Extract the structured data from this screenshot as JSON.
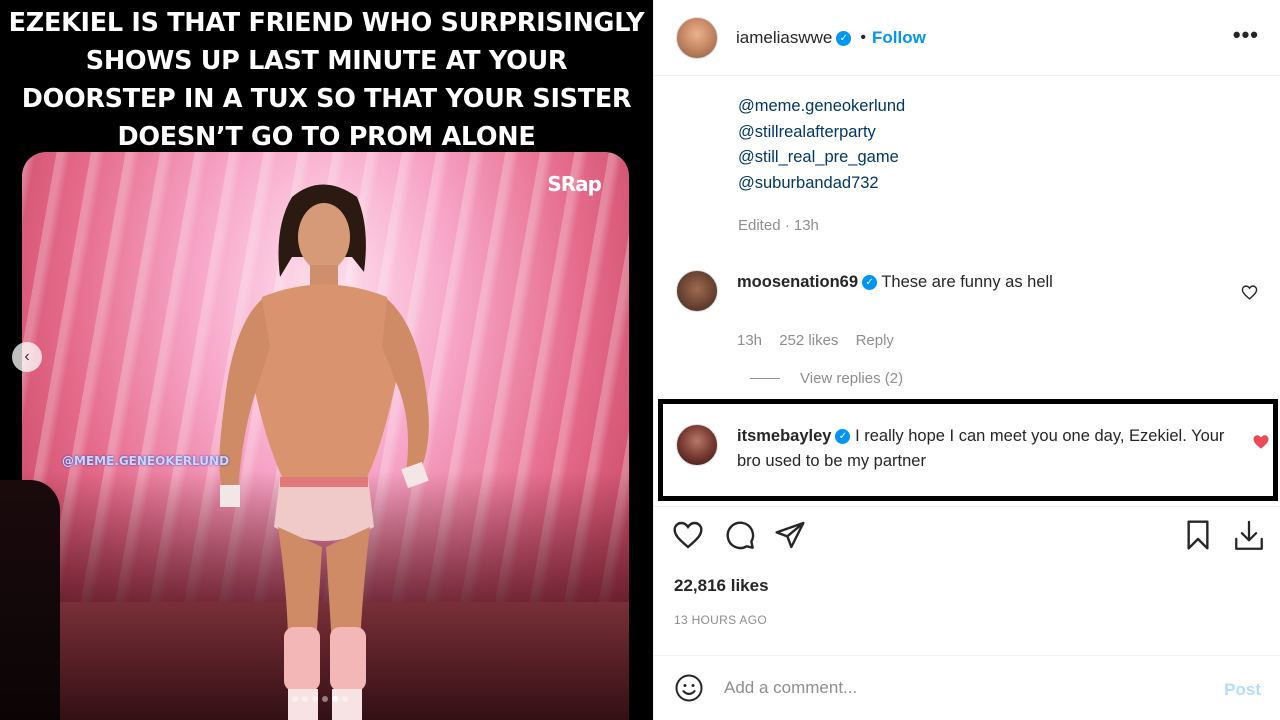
{
  "media": {
    "caption": "EZEKIEL IS THAT FRIEND WHO SURPRISINGLY SHOWS UP LAST MINUTE AT YOUR DOORSTEP IN A TUX SO THAT YOUR SISTER DOESN’T GO TO PROM ALONE",
    "logo": "SRap",
    "watermark": "@MEME.GENEOKERLUND",
    "carousel": {
      "count": 6,
      "active": 5
    }
  },
  "header": {
    "username": "iameliaswwe",
    "verified": true,
    "separator": "•",
    "follow_label": "Follow",
    "more_label": "•••"
  },
  "caption": {
    "mentions": [
      "@meme.geneokerlund",
      "@stillrealafterparty",
      "@still_real_pre_game",
      "@suburbandad732"
    ],
    "edited": "Edited · 13h"
  },
  "comments": [
    {
      "username": "moosenation69",
      "verified": true,
      "text": "These are funny as hell",
      "time": "13h",
      "likes": "252 likes",
      "reply_label": "Reply",
      "liked": false,
      "view_replies": "View replies (2)"
    },
    {
      "username": "itsmebayley",
      "verified": true,
      "text": "I really hope I can meet you one day, Ezekiel. Your bro used to be my partner",
      "liked": true
    }
  ],
  "post": {
    "likes": "22,816 likes",
    "time": "13 HOURS AGO"
  },
  "add_comment": {
    "placeholder": "Add a comment...",
    "post_label": "Post"
  },
  "colors": {
    "accent": "#0095f6",
    "mention": "#00376b",
    "muted": "#8e8e8e",
    "like_red": "#ed4956"
  },
  "icons": [
    "heart-icon",
    "comment-icon",
    "share-icon",
    "bookmark-icon",
    "download-icon",
    "emoji-icon",
    "verified-icon",
    "chevron-left-icon",
    "more-icon"
  ]
}
